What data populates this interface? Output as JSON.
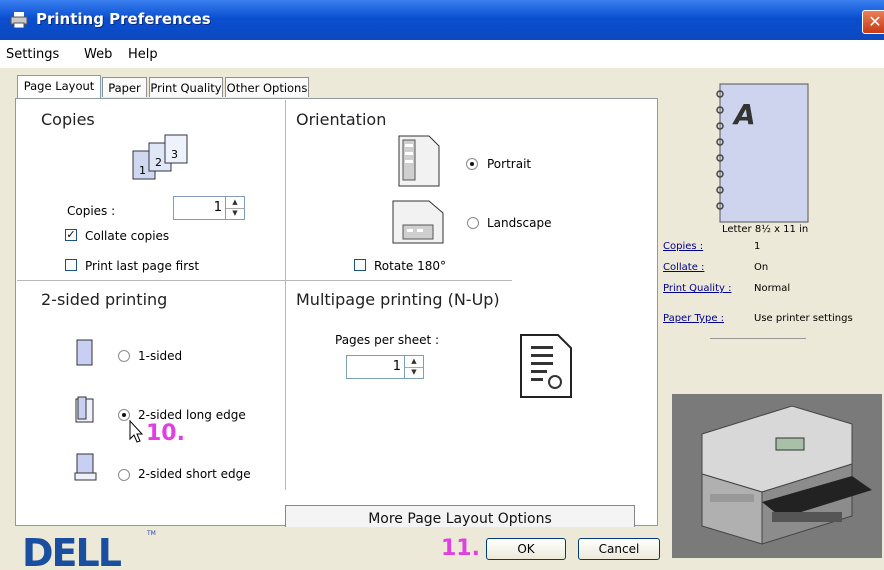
{
  "window": {
    "title": "Printing Preferences"
  },
  "menu": [
    "Settings",
    "Web",
    "Help"
  ],
  "tabs": [
    "Page Layout",
    "Paper",
    "Print Quality",
    "Other Options"
  ],
  "copies": {
    "heading": "Copies",
    "label": "Copies :",
    "value": "1",
    "collate_label": "Collate copies",
    "collate_checked": true,
    "last_first_label": "Print last page first",
    "last_first_checked": false
  },
  "orientation": {
    "heading": "Orientation",
    "portrait_label": "Portrait",
    "landscape_label": "Landscape",
    "selected": "Portrait",
    "rotate_label": "Rotate 180°",
    "rotate_checked": false
  },
  "twosided": {
    "heading": "2-sided printing",
    "options": [
      "1-sided",
      "2-sided long edge",
      "2-sided short edge"
    ],
    "selected": "2-sided long edge"
  },
  "nup": {
    "heading": "Multipage printing (N-Up)",
    "label": "Pages per sheet :",
    "value": "1"
  },
  "more_button": "More Page Layout Options",
  "annotations": {
    "step10": "10.",
    "step11": "11."
  },
  "buttons": {
    "ok": "OK",
    "cancel": "Cancel"
  },
  "brand": {
    "logo": "DELL",
    "tm": "TM"
  },
  "preview": {
    "page_letter": "A",
    "paper_size": "Letter 8½ x 11 in",
    "rows": [
      {
        "label": "Copies :",
        "value": "1"
      },
      {
        "label": "Collate :",
        "value": "On"
      },
      {
        "label": "Print Quality :",
        "value": "Normal"
      },
      {
        "label": "Paper Type :",
        "value": "Use printer settings"
      }
    ]
  },
  "colors": {
    "titlebar": "#0a4fd0",
    "annotation": "#e040e0",
    "dell_blue": "#1a4fa0",
    "link": "#00008b"
  }
}
